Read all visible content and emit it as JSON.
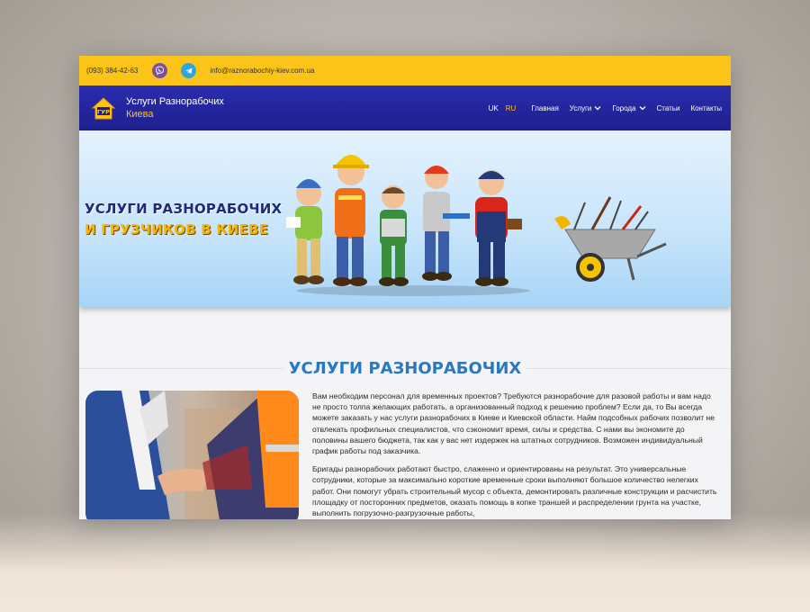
{
  "topbar": {
    "phone": "(093) 384-42-63",
    "email": "info@raznorabochiy-kiev.com.ua",
    "icons": [
      "viber-icon",
      "telegram-icon"
    ]
  },
  "brand": {
    "line1": "Услуги Разнорабочих",
    "line2": "Киева"
  },
  "nav": {
    "lang_uk": "UK",
    "lang_ru": "RU",
    "items": [
      "Главная",
      "Услуги",
      "Города",
      "Статьи",
      "Контакты"
    ]
  },
  "hero": {
    "title_line1": "УСЛУГИ РАЗНОРАБОЧИХ",
    "title_line2": "И ГРУЗЧИКОВ В КИЕВЕ"
  },
  "section": {
    "title": "УСЛУГИ РАЗНОРАБОЧИХ",
    "paragraph1": "Вам необходим персонал для временных проектов? Требуются разнорабочие для разовой работы и вам надо не просто толпа желающих работать, а организованный подход к решению проблем? Если да, то Вы всегда можете заказать у нас услуги разнорабочих в Киеве и Киевской области. Найм подсобных рабочих позволит не отвлекать профильных специалистов, что сэкономит время, силы и средства. С нами вы экономите до половины вашего бюджета, так как у вас нет издержек на штатных сотрудников. Возможен индивидуальный график работы под заказчика.",
    "paragraph2": "Бригады разнорабочих работают быстро, слаженно и ориентированы на результат. Это универсальные сотрудники, которые за максимально короткие временные сроки выполняют большое количество нелегких работ. Они помогут убрать строительный мусор с объекта, демонтировать различные конструкции и расчистить площадку от посторонних предметов, оказать помощь в копке траншей и распределении грунта на участке, выполнить погрузочно-разгрузочные работы,"
  },
  "colors": {
    "topbar": "#fcc419",
    "navbar": "#1e1f8f",
    "accent_yellow": "#fcc419",
    "section_title": "#2b78c0"
  }
}
